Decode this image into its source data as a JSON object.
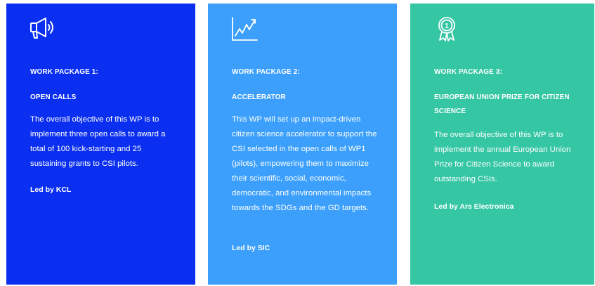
{
  "colors": {
    "card_1_bg": "#0b2ff0",
    "card_2_bg": "#3b9ffb",
    "card_3_bg": "#35c6a3",
    "text": "#ffffff"
  },
  "cards": [
    {
      "icon": "megaphone-icon",
      "number": "WORK PACKAGE 1:",
      "title": "OPEN CALLS",
      "description": "The overall objective of this WP is to implement three open calls to award a total of 100 kick-starting and 25 sustaining grants to CSI pilots.",
      "lead": "Led by KCL"
    },
    {
      "icon": "line-chart-icon",
      "number": "WORK PACKAGE 2:",
      "title": "ACCELERATOR",
      "description": "This WP will set up an impact-driven citizen science accelerator to support the CSI selected in the open calls of WP1 (pilots), empowering them to maximize their scientific, social, economic, democratic, and environmental impacts towards the SDGs and the GD targets.",
      "lead": "Led by SIC"
    },
    {
      "icon": "award-medal-icon",
      "icon_text": "1",
      "number": "WORK PACKAGE 3:",
      "title": "EUROPEAN UNION PRIZE FOR CITIZEN SCIENCE",
      "description": "The overall objective of this WP is to implement the annual European Union Prize for Citizen Science to award outstanding CSIs.",
      "lead": "Led by Ars Electronica"
    }
  ]
}
